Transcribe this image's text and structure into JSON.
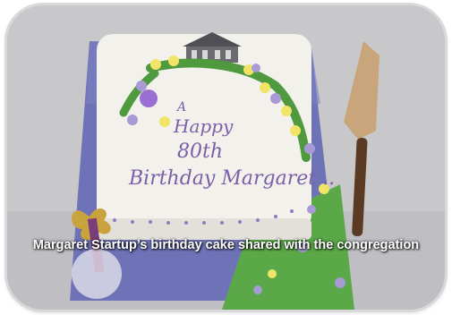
{
  "photo": {
    "subject": "birthday-cake",
    "icing_text_lines": [
      "A",
      "Happy",
      "80th",
      "Birthday Margaret .."
    ]
  },
  "caption": "Margaret Startup’s birthday cake shared with the congregation",
  "colors": {
    "background": "#c9c9cc",
    "board": "#6f74b8",
    "icing": "#f4f2ee",
    "lettering": "#7a5fa8",
    "grass": "#5aa848"
  }
}
